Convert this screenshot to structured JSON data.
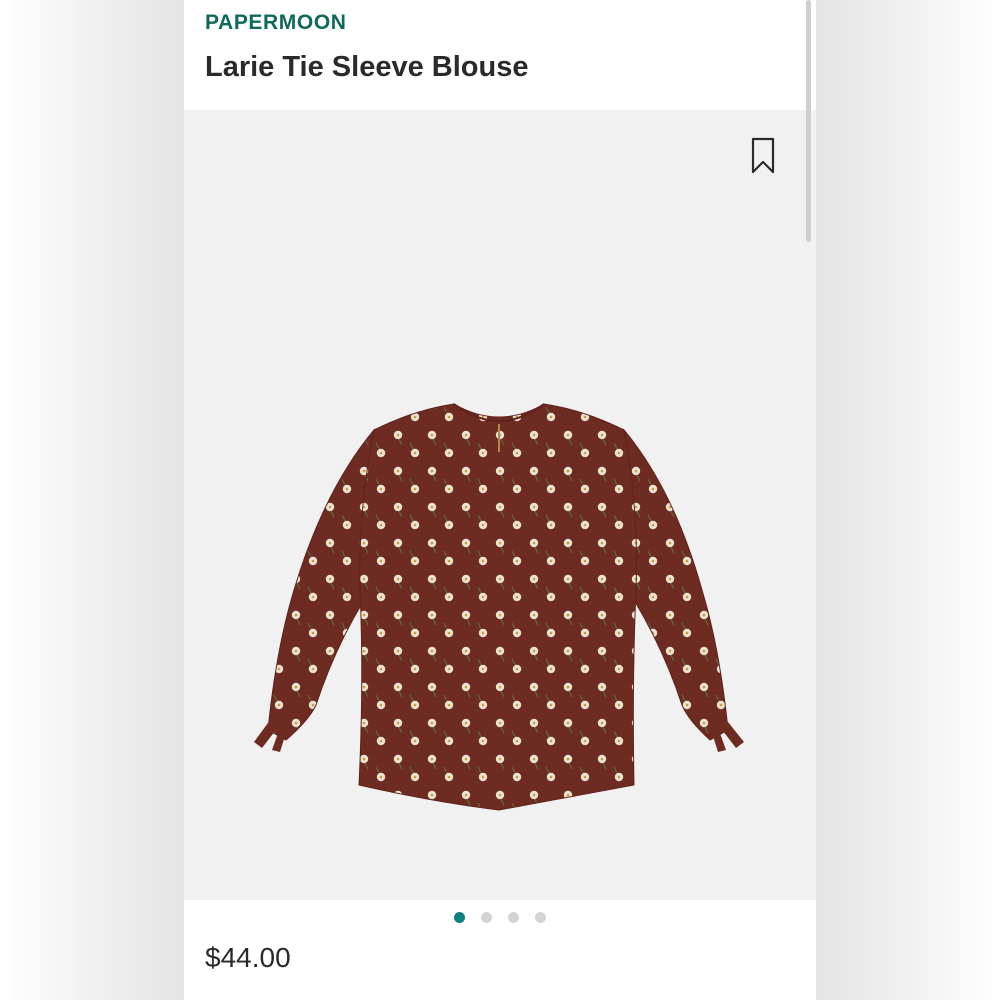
{
  "product": {
    "brand": "PAPERMOON",
    "name": "Larie Tie Sleeve Blouse",
    "price": "$44.00"
  },
  "image": {
    "subject": "blouse-image",
    "fabric_color": "#6e2b22",
    "print_color": "#ece3d2"
  },
  "carousel": {
    "count": 4,
    "active_index": 0
  },
  "icons": {
    "bookmark": "bookmark-icon"
  },
  "colors": {
    "brand_green": "#0f6a5c",
    "indicator_active": "#0e7f80",
    "indicator_inactive": "#d4d4d4"
  }
}
